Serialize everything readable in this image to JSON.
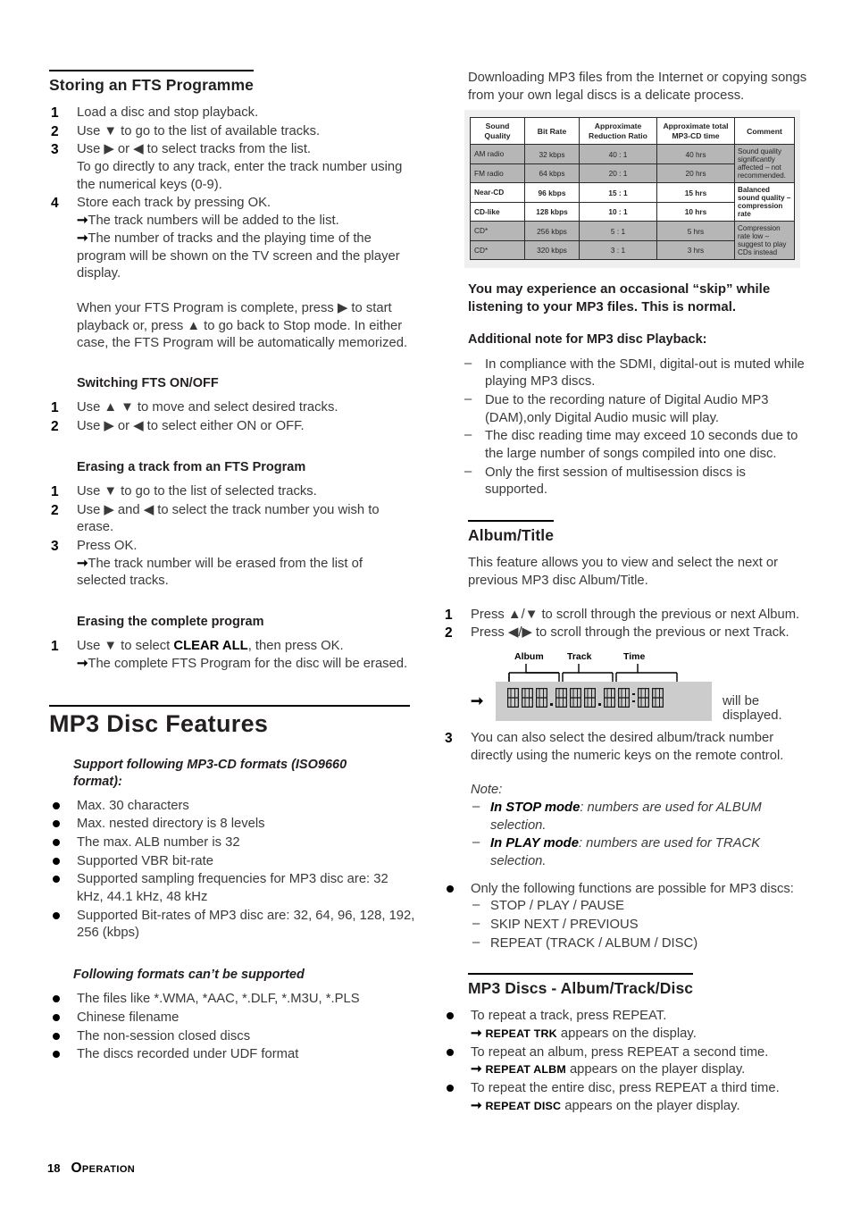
{
  "page": {
    "number": "18",
    "section_label": "Operation"
  },
  "left": {
    "storing": {
      "heading": "Storing an FTS Programme",
      "steps": [
        {
          "n": "1",
          "text": "Load a disc and stop playback."
        },
        {
          "n": "2",
          "text": "Use ▼ to go to the list of available tracks."
        },
        {
          "n": "3",
          "text": "Use ▶ or ◀ to select tracks from the list.",
          "extra": "To go directly to any track, enter the track number using the numerical keys (0-9)."
        },
        {
          "n": "4",
          "text": "Store each track by pressing OK.",
          "arrow1": "The track numbers will be added to the list.",
          "arrow2": "The number of tracks and the playing time of the program will be shown on the TV screen and the player display."
        }
      ],
      "paragraph": "When your FTS Program is complete, press ▶ to start playback or, press ▲ to go back to Stop mode. In either case, the FTS Program will be automatically memorized."
    },
    "switching": {
      "heading": "Switching FTS ON/OFF",
      "steps": [
        {
          "n": "1",
          "text": "Use ▲ ▼ to move and select desired tracks."
        },
        {
          "n": "2",
          "text": "Use ▶ or ◀ to select either ON or OFF."
        }
      ]
    },
    "erasing_track": {
      "heading": "Erasing a track from an FTS Program",
      "steps": [
        {
          "n": "1",
          "text": "Use ▼ to go to the list of selected tracks."
        },
        {
          "n": "2",
          "text": "Use ▶ and ◀ to select the track number you wish to erase."
        },
        {
          "n": "3",
          "text": "Press OK.",
          "arrow1": "The track number will be erased from the list of selected tracks."
        }
      ]
    },
    "erasing_all": {
      "heading": "Erasing the complete program",
      "step_num": "1",
      "step_pre": "Use ▼ to select ",
      "step_bold": "CLEAR ALL",
      "step_post": ", then press OK.",
      "arrow1": "The complete FTS Program for the disc will be erased."
    },
    "mp3_features": {
      "title": "MP3 Disc Features",
      "support_heading": "Support following MP3-CD formats (ISO9660 format):",
      "support_items": [
        "Max. 30 characters",
        "Max. nested directory is 8 levels",
        "The max. ALB number is 32",
        "Supported VBR bit-rate",
        "Supported sampling frequencies for MP3 disc are: 32 kHz, 44.1 kHz, 48 kHz",
        "Supported Bit-rates of MP3 disc are: 32, 64, 96, 128, 192, 256 (kbps)"
      ],
      "unsupported_heading": "Following formats can’t be supported",
      "unsupported_items": [
        "The files like *.WMA, *AAC, *.DLF, *.M3U, *.PLS",
        "Chinese filename",
        "The non-session closed discs",
        "The discs recorded under UDF format"
      ]
    }
  },
  "right": {
    "intro": "Downloading MP3 files from the Internet or copying songs from your own legal discs is a delicate process.",
    "table": {
      "headers": [
        "Sound Quality",
        "Bit Rate",
        "Approximate Reduction Ratio",
        "Approximate total MP3-CD time",
        "Comment"
      ],
      "rows": [
        {
          "quality": "AM radio",
          "bitrate": "32 kbps",
          "ratio": "40 : 1",
          "time": "40 hrs",
          "style": "gray"
        },
        {
          "quality": "FM radio",
          "bitrate": "64 kbps",
          "ratio": "20 : 1",
          "time": "20 hrs",
          "style": "gray"
        },
        {
          "quality": "Near-CD",
          "bitrate": "96 kbps",
          "ratio": "15 : 1",
          "time": "15 hrs",
          "style": "white"
        },
        {
          "quality": "CD-like",
          "bitrate": "128 kbps",
          "ratio": "10 : 1",
          "time": "10 hrs",
          "style": "white"
        },
        {
          "quality": "CD*",
          "bitrate": "256 kbps",
          "ratio": "5 : 1",
          "time": "5 hrs",
          "style": "gray"
        },
        {
          "quality": "CD*",
          "bitrate": "320 kbps",
          "ratio": "3 : 1",
          "time": "3 hrs",
          "style": "gray"
        }
      ],
      "comments": [
        {
          "text": "Sound quality significantly affected – not recommended.",
          "span": 2,
          "style": "gray"
        },
        {
          "text": "Balanced sound quality – compression rate",
          "span": 2,
          "style": "white"
        },
        {
          "text": "Compression rate low – suggest to play CDs instead",
          "span": 2,
          "style": "gray"
        }
      ]
    },
    "skip_note": "You may experience an occasional “skip” while listening to your MP3 files. This is normal.",
    "additional": {
      "heading": "Additional note for MP3 disc Playback:",
      "items": [
        "In compliance with the SDMI, digital-out is muted while playing MP3 discs.",
        "Due to the recording nature of Digital Audio MP3 (DAM),only Digital Audio music will play.",
        "The disc reading time may exceed 10 seconds due to the large number of songs compiled into one disc.",
        "Only the first session of multisession discs is supported."
      ]
    },
    "album_title": {
      "heading": "Album/Title",
      "intro": "This feature allows you to view and select the next or previous MP3 disc Album/Title.",
      "steps": [
        {
          "n": "1",
          "text": "Press ▲/▼ to scroll through the previous or next Album."
        },
        {
          "n": "2",
          "text": "Press ◀/▶ to scroll through the previous or next Track."
        }
      ],
      "display": {
        "labels": [
          "Album",
          "Track",
          "Time"
        ],
        "caption": "will be displayed."
      },
      "step3_num": "3",
      "step3": "You can also select the desired album/track number directly using the numeric keys on the remote control.",
      "note_label": "Note:",
      "notes": [
        {
          "bold": "In STOP mode",
          "rest": ": numbers are used for ALBUM selection."
        },
        {
          "bold": "In PLAY mode",
          "rest": ": numbers are used for TRACK selection."
        }
      ],
      "functions_lead": "Only the following functions are possible for MP3 discs:",
      "functions": [
        "STOP / PLAY / PAUSE",
        "SKIP NEXT / PREVIOUS",
        "REPEAT (TRACK / ALBUM / DISC)"
      ]
    },
    "mp3_discs": {
      "heading": "MP3 Discs - Album/Track/Disc",
      "items": [
        {
          "text": "To repeat a track, press REPEAT.",
          "kbd": "REPEAT TRK",
          "after": " appears on the display."
        },
        {
          "text": "To repeat an album, press REPEAT a second time.",
          "kbd": "REPEAT ALBM",
          "after": " appears on the player display."
        },
        {
          "text": "To repeat the entire disc, press REPEAT a third time.",
          "kbd": "REPEAT DISC",
          "after": " appears on the player display."
        }
      ]
    }
  }
}
